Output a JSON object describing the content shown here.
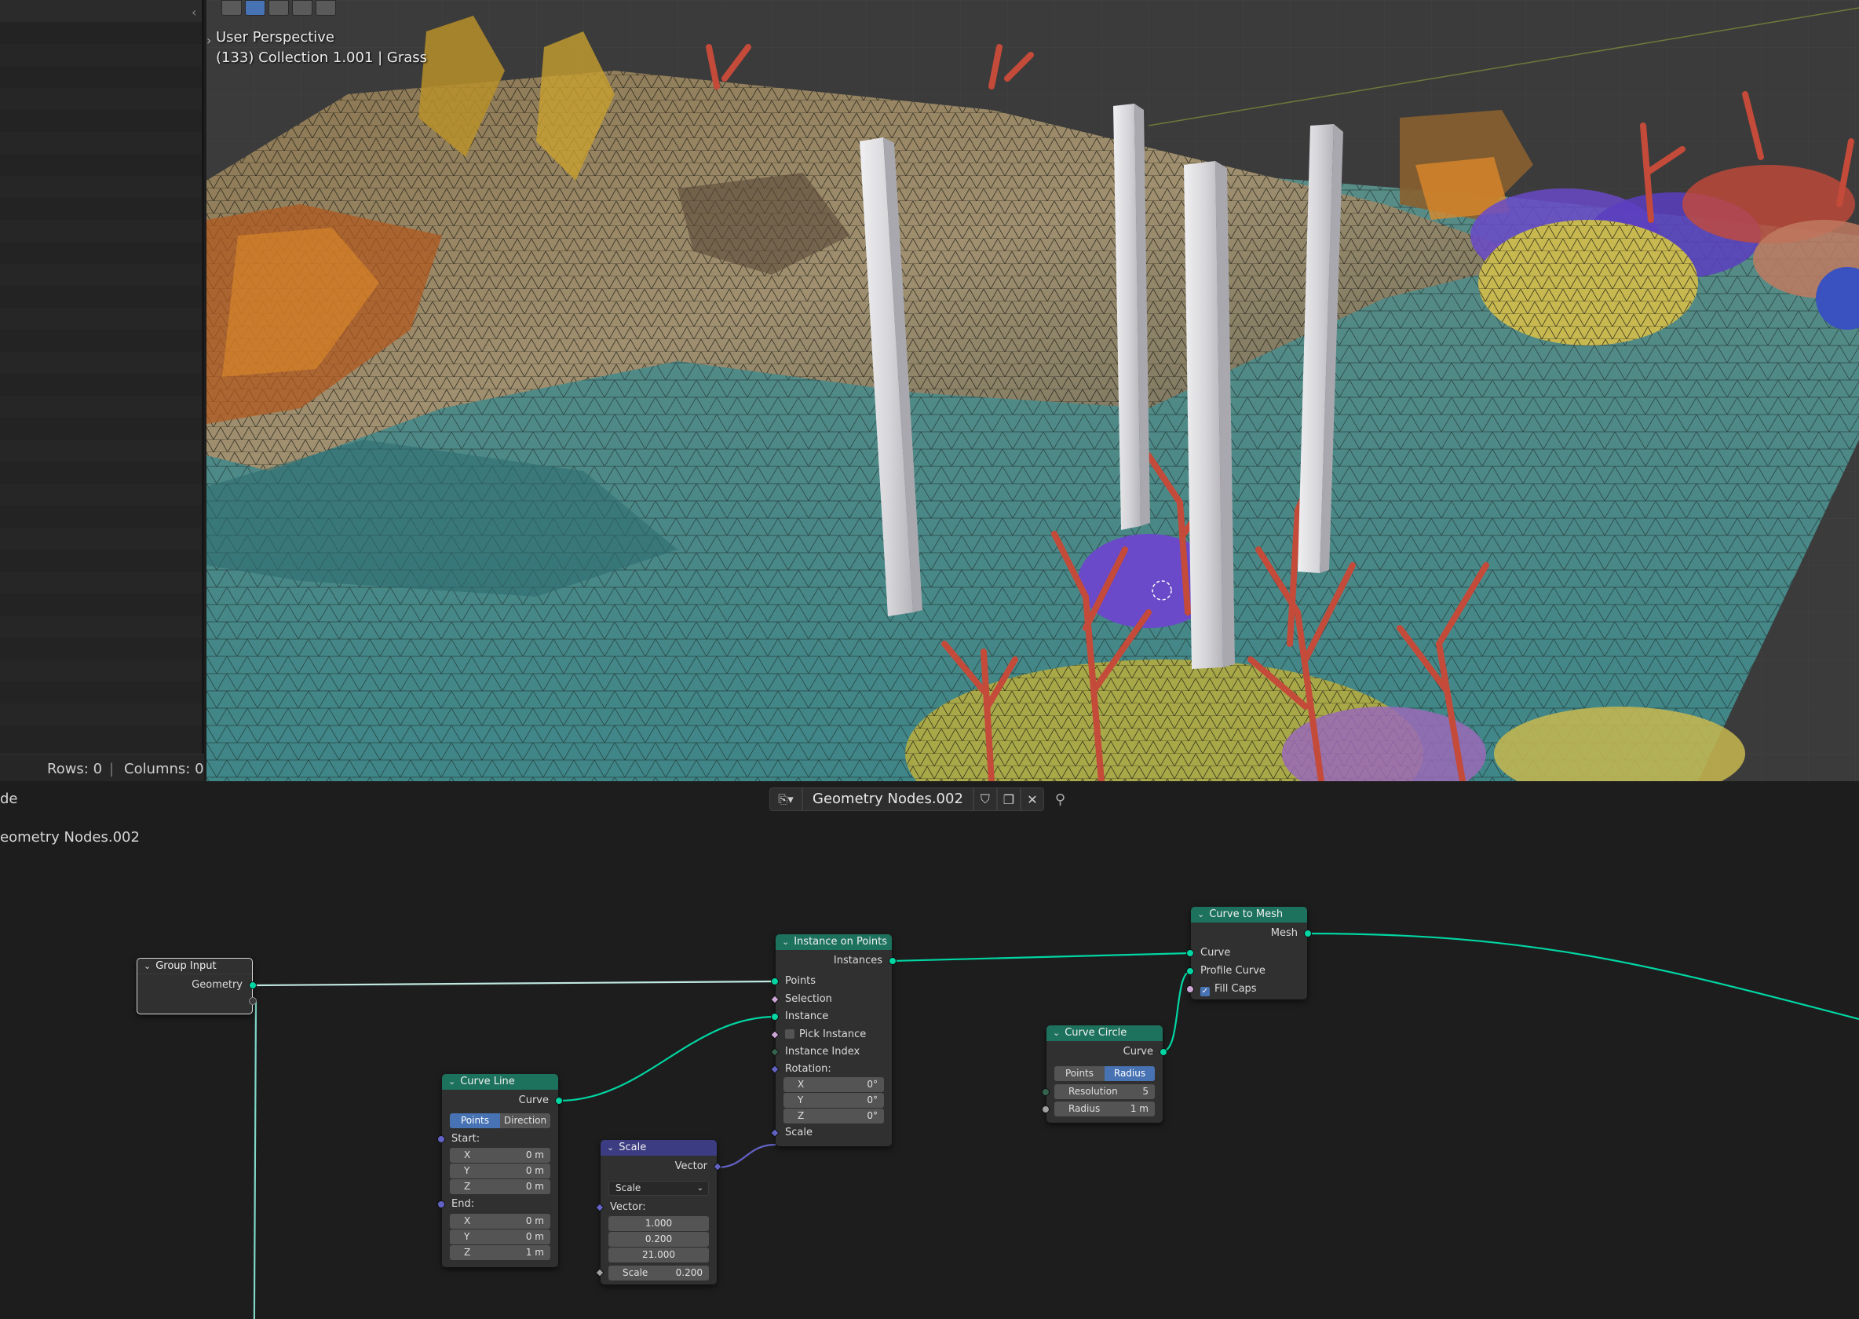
{
  "spreadsheet": {
    "rows_label": "Rows: 0",
    "columns_label": "Columns: 0"
  },
  "viewport": {
    "view_name": "User Perspective",
    "view_info": "(133) Collection 1.001 | Grass",
    "colors": {
      "sand": "#4a8c8a",
      "wreck": "#7a6a50",
      "pillar": "#d8d8dc",
      "coral_red": "#c44a3a",
      "coral_purple": "#6a4ac8",
      "coral_yellow": "#c8b850"
    }
  },
  "node_editor": {
    "mode_label": "de",
    "tree_name": "Geometry Nodes.002",
    "breadcrumb": "eometry Nodes.002",
    "nodes": {
      "group_input": {
        "title": "Group Input",
        "out_geometry": "Geometry"
      },
      "curve_line": {
        "title": "Curve Line",
        "out_curve": "Curve",
        "mode_points": "Points",
        "mode_direction": "Direction",
        "start_label": "Start:",
        "end_label": "End:",
        "start": {
          "x_label": "X",
          "x": "0 m",
          "y_label": "Y",
          "y": "0 m",
          "z_label": "Z",
          "z": "0 m"
        },
        "end": {
          "x_label": "X",
          "x": "0 m",
          "y_label": "Y",
          "y": "0 m",
          "z_label": "Z",
          "z": "1 m"
        }
      },
      "scale": {
        "title": "Scale",
        "out_vector": "Vector",
        "operation": "Scale",
        "vector_label": "Vector:",
        "v1": "1.000",
        "v2": "0.200",
        "v3": "21.000",
        "scale_label": "Scale",
        "scale_value": "0.200"
      },
      "instance_on_points": {
        "title": "Instance on Points",
        "out_instances": "Instances",
        "in_points": "Points",
        "in_selection": "Selection",
        "in_instance": "Instance",
        "in_pick_instance": "Pick Instance",
        "in_instance_index": "Instance Index",
        "rotation_label": "Rotation:",
        "rot": {
          "x_label": "X",
          "x": "0°",
          "y_label": "Y",
          "y": "0°",
          "z_label": "Z",
          "z": "0°"
        },
        "in_scale": "Scale"
      },
      "curve_circle": {
        "title": "Curve Circle",
        "out_curve": "Curve",
        "mode_points": "Points",
        "mode_radius": "Radius",
        "resolution_label": "Resolution",
        "resolution": "5",
        "radius_label": "Radius",
        "radius": "1 m"
      },
      "curve_to_mesh": {
        "title": "Curve to Mesh",
        "out_mesh": "Mesh",
        "in_curve": "Curve",
        "in_profile_curve": "Profile Curve",
        "in_fill_caps": "Fill Caps"
      }
    }
  }
}
